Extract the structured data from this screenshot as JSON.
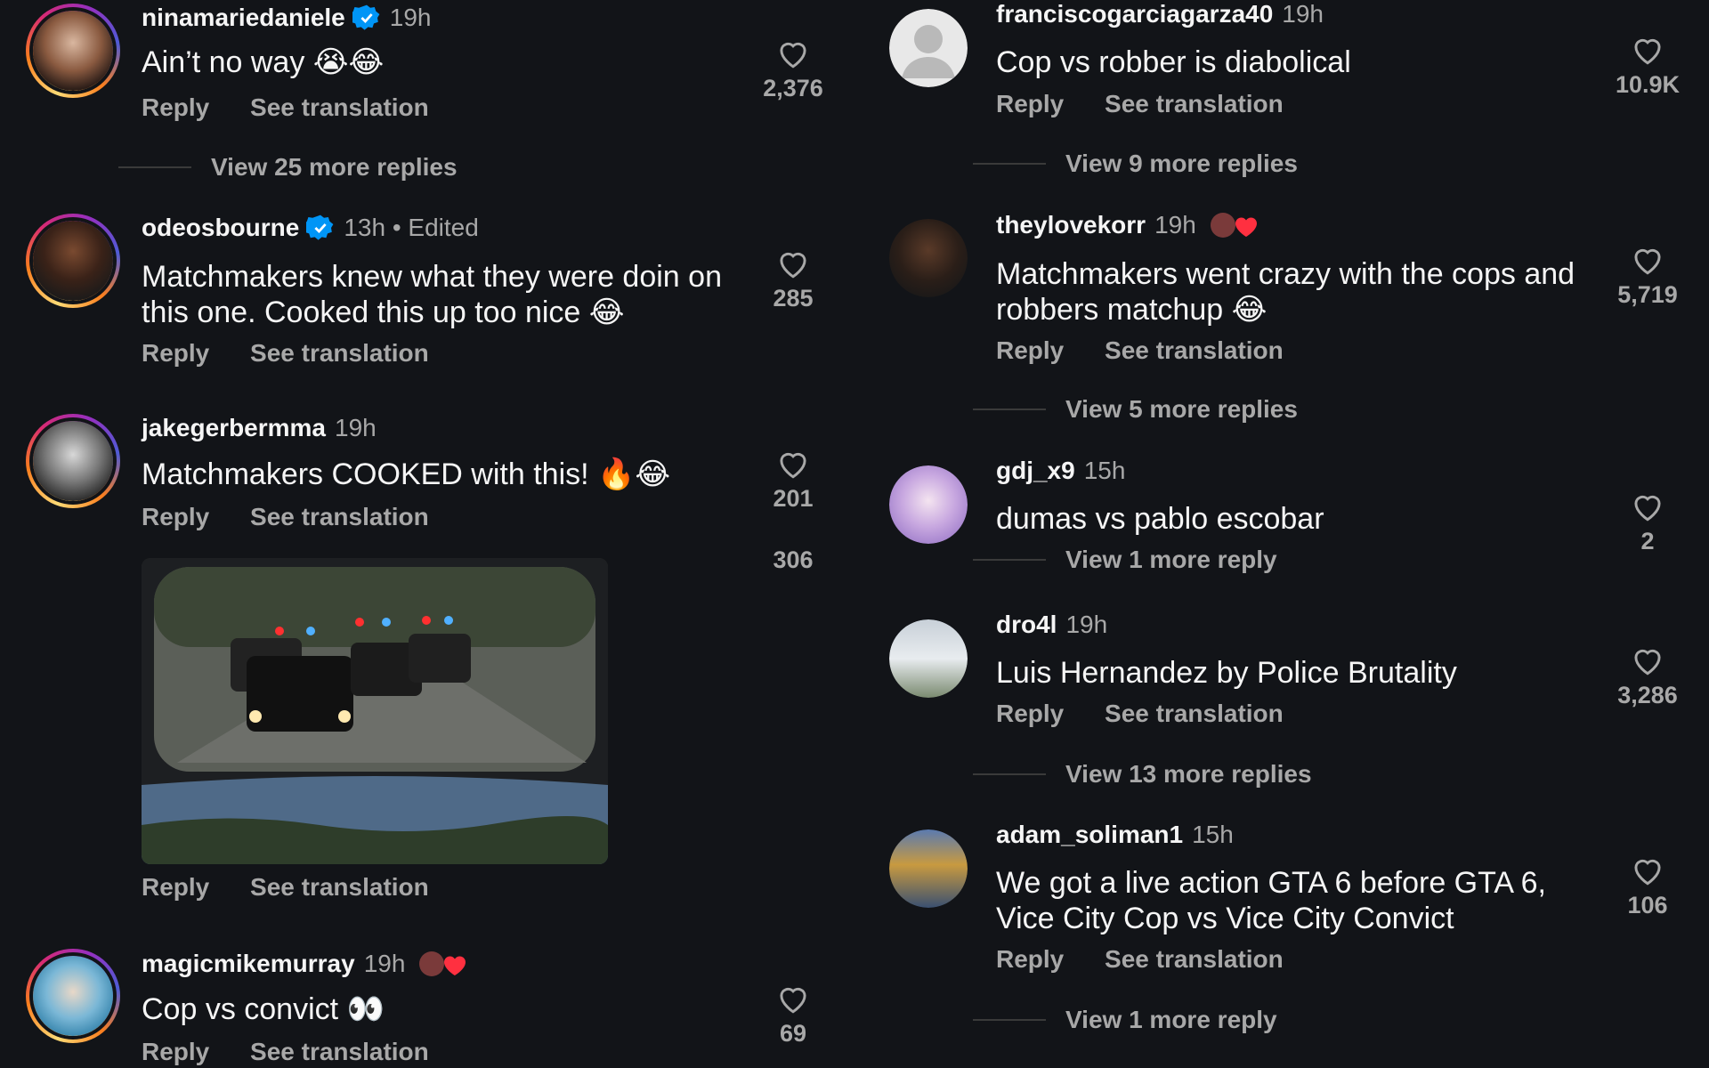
{
  "colors": {
    "background": "#121418",
    "text": "#f5f5f5",
    "muted": "#a8a8a8",
    "verified": "#0095f6",
    "heart_red": "#ff3040"
  },
  "labels": {
    "reply": "Reply",
    "see_translation": "See translation"
  },
  "left": {
    "c1": {
      "username": "ninamariedaniele",
      "verified": true,
      "time": "19h",
      "text": "Ain’t no way 😭😂",
      "likes": "2,376",
      "more": "View 25 more replies"
    },
    "c2": {
      "username": "odeosbourne",
      "verified": true,
      "time": "13h • Edited",
      "text": "Matchmakers knew what they were doin on this one. Cooked this up too nice 😂",
      "likes": "285"
    },
    "c3": {
      "username": "jakegerbermma",
      "time": "19h",
      "text": "Matchmakers COOKED with this! 🔥😂",
      "likes": "201",
      "likes_partial": "306"
    },
    "c4": {
      "username": "magicmikemurray",
      "time": "19h",
      "text": "Cop vs convict 👀",
      "likes": "69"
    }
  },
  "right": {
    "c1": {
      "username": "franciscogarciagarza40",
      "time": "19h",
      "text": "Cop vs robber is diabolical",
      "likes": "10.9K",
      "more": "View 9 more replies"
    },
    "c2": {
      "username": "theylovekorr",
      "time": "19h",
      "text": "Matchmakers went crazy with the cops and robbers matchup 😂",
      "likes": "5,719",
      "more": "View 5 more replies"
    },
    "c3": {
      "username": "gdj_x9",
      "time": "15h",
      "text": "dumas vs pablo escobar",
      "likes": "2",
      "more": "View 1 more reply"
    },
    "c4": {
      "username": "dro4l",
      "time": "19h",
      "text": "Luis Hernandez by Police Brutality",
      "likes": "3,286",
      "more": "View 13 more replies"
    },
    "c5": {
      "username": "adam_soliman1",
      "time": "15h",
      "text": "We got a live action GTA 6 before GTA 6, Vice City Cop vs Vice City Convict",
      "likes": "106",
      "more": "View 1 more reply"
    }
  }
}
